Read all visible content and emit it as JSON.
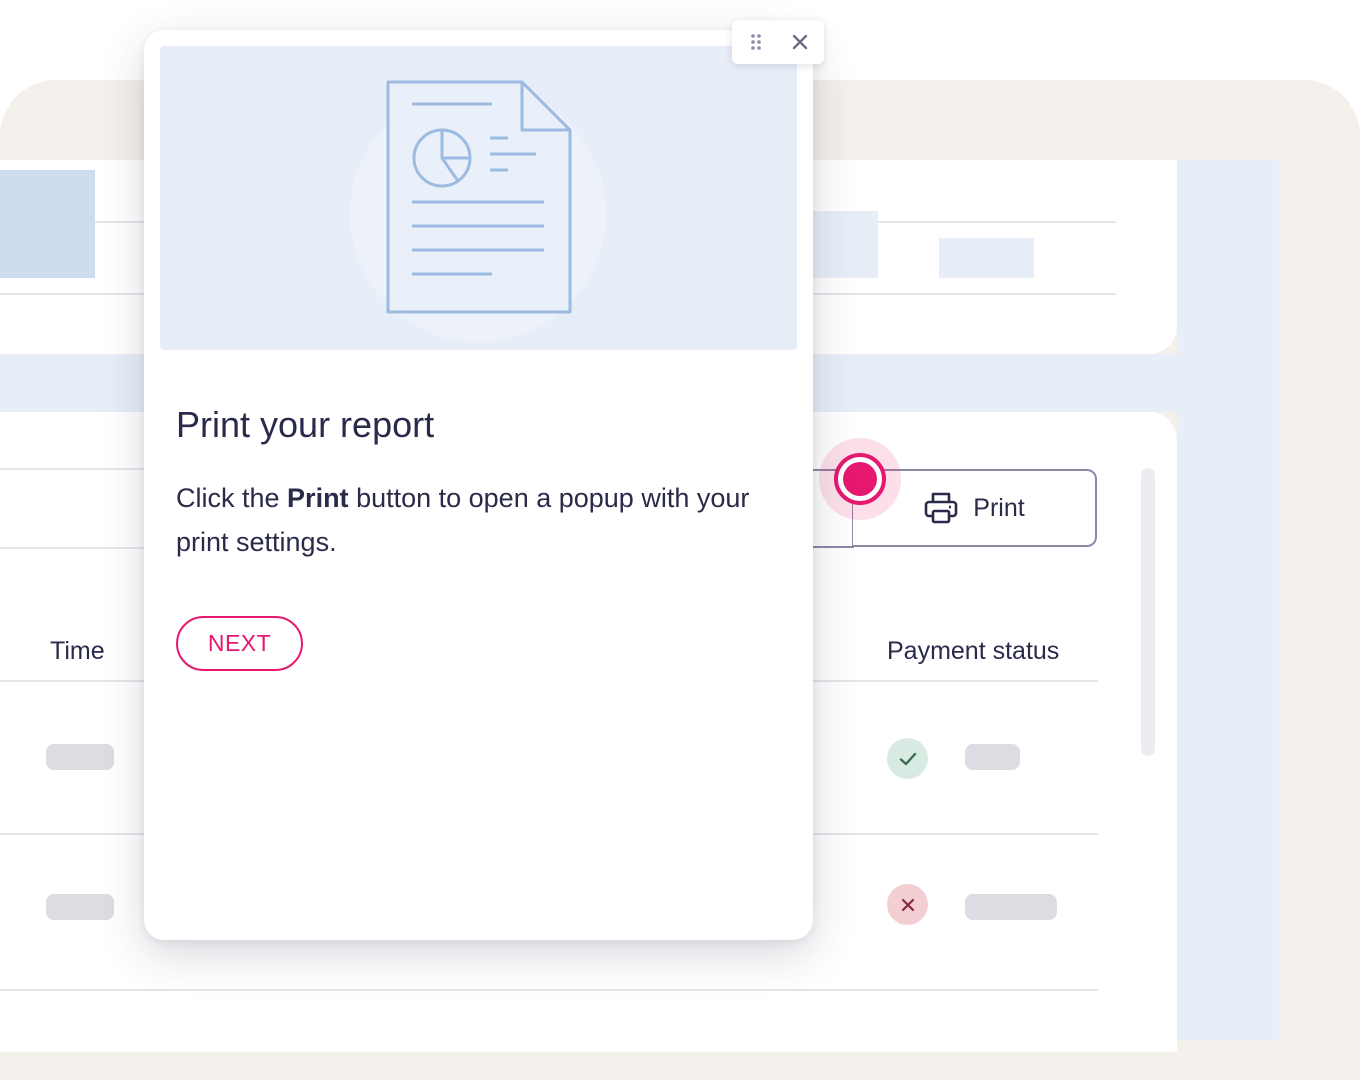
{
  "tour": {
    "title": "Print your report",
    "body_before": "Click the ",
    "body_bold": "Print",
    "body_after": " button to open a popup with your print settings.",
    "next_label": "NEXT",
    "controls": {
      "drag_icon": "drag-handle-icon",
      "close_icon": "close-icon"
    },
    "hero_icon": "report-document-icon"
  },
  "toolbar": {
    "print_label": "Print",
    "print_icon": "printer-icon"
  },
  "table": {
    "headers": {
      "time": "Time",
      "payment_status": "Payment status"
    },
    "rows": [
      {
        "status": "paid",
        "status_icon": "check-icon"
      },
      {
        "status": "failed",
        "status_icon": "x-icon"
      }
    ]
  },
  "colors": {
    "accent": "#e6186f",
    "text": "#2a2a4a",
    "panel_blue": "#e7eef8",
    "frame_beige": "#f4f0eb",
    "icon_blue": "#9dbbe0",
    "success_bg": "#d8ebe3",
    "success_fg": "#3d6b55",
    "error_bg": "#f3cfd3",
    "error_fg": "#8a2a38"
  }
}
